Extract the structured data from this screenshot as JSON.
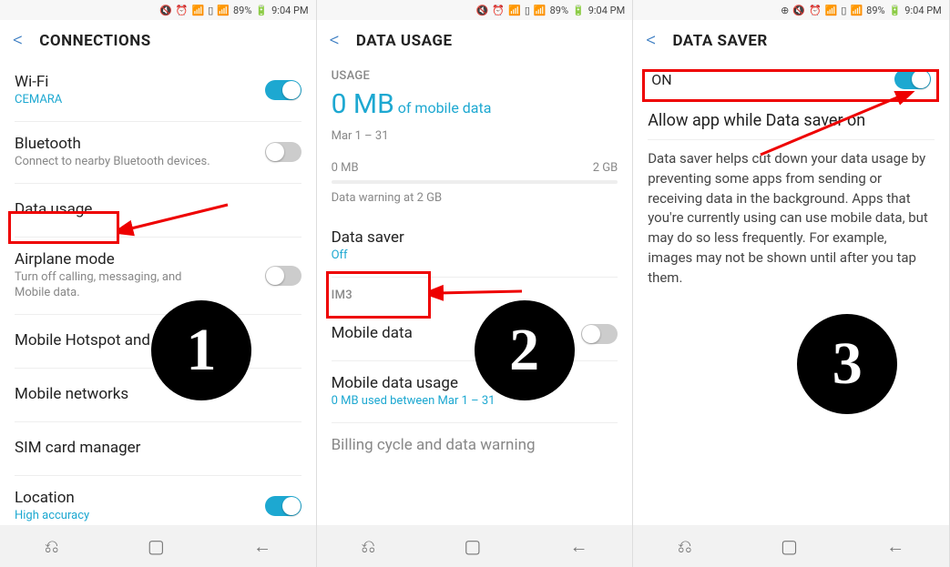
{
  "status": {
    "battery": "89%",
    "time": "9:04 PM"
  },
  "panel1": {
    "title": "CONNECTIONS",
    "wifi": {
      "label": "Wi-Fi",
      "sub": "CEMARA"
    },
    "bluetooth": {
      "label": "Bluetooth",
      "sub": "Connect to nearby Bluetooth devices."
    },
    "datausage": {
      "label": "Data usage"
    },
    "airplane": {
      "label": "Airplane mode",
      "sub": "Turn off calling, messaging, and Mobile data."
    },
    "hotspot": {
      "label": "Mobile Hotspot and Tethering"
    },
    "networks": {
      "label": "Mobile networks"
    },
    "sim": {
      "label": "SIM card manager"
    },
    "location": {
      "label": "Location",
      "sub": "High accuracy"
    }
  },
  "panel2": {
    "title": "DATA USAGE",
    "usage_label": "USAGE",
    "usage_amount": "0 MB",
    "usage_suffix": "of mobile data",
    "date_range": "Mar 1 – 31",
    "min": "0 MB",
    "max": "2 GB",
    "warning": "Data warning at 2 GB",
    "datasaver": {
      "label": "Data saver",
      "sub": "Off"
    },
    "carrier": "IM3",
    "mobiledata": {
      "label": "Mobile data"
    },
    "mobileusage": {
      "label": "Mobile data usage",
      "sub": "0 MB used between Mar 1 – 31"
    },
    "billing": {
      "label": "Billing cycle and data warning"
    }
  },
  "panel3": {
    "title": "DATA SAVER",
    "on_label": "ON",
    "allow": "Allow app while Data saver on",
    "desc": "Data saver helps cut down your data usage by preventing some apps from sending or receiving data in the background. Apps that you're currently using can use mobile data, but may do so less frequently. For example, images may not be shown until after you tap them."
  },
  "badges": {
    "one": "1",
    "two": "2",
    "three": "3"
  }
}
